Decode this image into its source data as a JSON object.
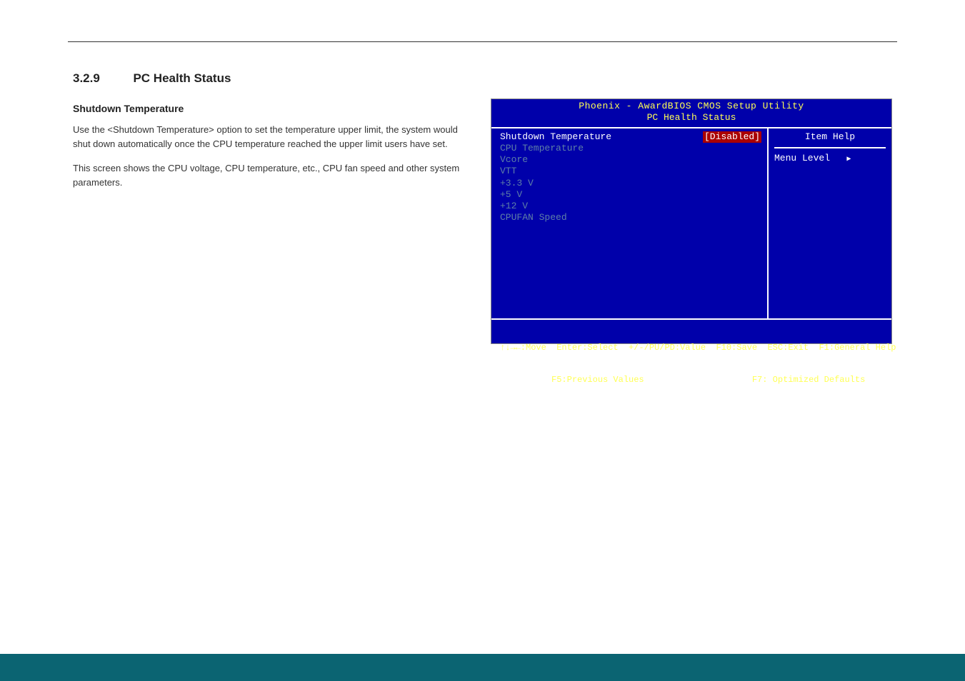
{
  "section": {
    "number": "3.2.9",
    "title": "PC Health Status"
  },
  "text": {
    "subhead": "Shutdown Temperature",
    "p1": "Use the <Shutdown Temperature> option to set the temperature upper limit, the system would shut down automatically once the CPU temperature reached the upper limit users have set.",
    "p2": "This screen shows the CPU voltage, CPU temperature, etc., CPU fan speed and other system parameters."
  },
  "bios": {
    "header1": "Phoenix - AwardBIOS CMOS Setup Utility",
    "header2": "PC Health Status",
    "left": {
      "item_shutdown_label": "Shutdown Temperature",
      "item_shutdown_value": "[Disabled]",
      "dim_items": [
        "CPU Temperature",
        "Vcore",
        "VTT",
        "+3.3 V",
        "+5 V",
        "+12 V",
        "CPUFAN Speed"
      ]
    },
    "right": {
      "head": "Item Help",
      "menu_level_label": "Menu Level"
    },
    "footer1": "↑↓→←:Move  Enter:Select  +/-/PU/PD:Value  F10:Save  ESC:Exit  F1:General Help",
    "footer2": "          F5:Previous Values                     F7: Optimized Defaults"
  }
}
